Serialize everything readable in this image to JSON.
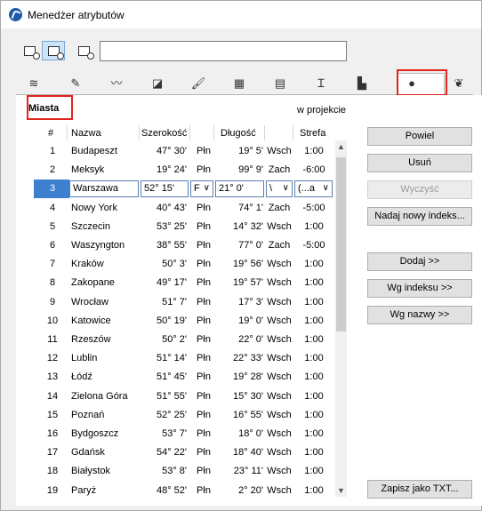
{
  "window": {
    "title": "Menedżer atrybutów"
  },
  "search": {
    "value": ""
  },
  "panel": {
    "title": "Miasta",
    "projection_label": "w projekcie"
  },
  "columns": [
    "#",
    "Nazwa",
    "Szerokość",
    "Długość",
    "Strefa"
  ],
  "rows": [
    {
      "num": "1",
      "name": "Budapeszt",
      "lat": "47° 30'",
      "latdir": "Płn",
      "lon": "19° 5'",
      "londir": "Wsch",
      "zone": "1:00"
    },
    {
      "num": "2",
      "name": "Meksyk",
      "lat": "19° 24'",
      "latdir": "Płn",
      "lon": "99° 9'",
      "londir": "Zach",
      "zone": "-6:00"
    },
    {
      "num": "3",
      "name": "Warszawa",
      "lat": "52° 15'",
      "latdir": "F",
      "lon": "21° 0'",
      "londir": "\\",
      "zone": "(...a",
      "selected": true
    },
    {
      "num": "4",
      "name": "Nowy York",
      "lat": "40° 43'",
      "latdir": "Płn",
      "lon": "74° 1'",
      "londir": "Zach",
      "zone": "-5:00"
    },
    {
      "num": "5",
      "name": "Szczecin",
      "lat": "53° 25'",
      "latdir": "Płn",
      "lon": "14° 32'",
      "londir": "Wsch",
      "zone": "1:00"
    },
    {
      "num": "6",
      "name": "Waszyngton",
      "lat": "38° 55'",
      "latdir": "Płn",
      "lon": "77° 0'",
      "londir": "Zach",
      "zone": "-5:00"
    },
    {
      "num": "7",
      "name": "Kraków",
      "lat": "50° 3'",
      "latdir": "Płn",
      "lon": "19° 56'",
      "londir": "Wsch",
      "zone": "1:00"
    },
    {
      "num": "8",
      "name": "Zakopane",
      "lat": "49° 17'",
      "latdir": "Płn",
      "lon": "19° 57'",
      "londir": "Wsch",
      "zone": "1:00"
    },
    {
      "num": "9",
      "name": "Wrocław",
      "lat": "51° 7'",
      "latdir": "Płn",
      "lon": "17° 3'",
      "londir": "Wsch",
      "zone": "1:00"
    },
    {
      "num": "10",
      "name": "Katowice",
      "lat": "50° 19'",
      "latdir": "Płn",
      "lon": "19° 0'",
      "londir": "Wsch",
      "zone": "1:00"
    },
    {
      "num": "11",
      "name": "Rzeszów",
      "lat": "50° 2'",
      "latdir": "Płn",
      "lon": "22° 0'",
      "londir": "Wsch",
      "zone": "1:00"
    },
    {
      "num": "12",
      "name": "Lublin",
      "lat": "51° 14'",
      "latdir": "Płn",
      "lon": "22° 33'",
      "londir": "Wsch",
      "zone": "1:00"
    },
    {
      "num": "13",
      "name": "Łódź",
      "lat": "51° 45'",
      "latdir": "Płn",
      "lon": "19° 28'",
      "londir": "Wsch",
      "zone": "1:00"
    },
    {
      "num": "14",
      "name": "Zielona Góra",
      "lat": "51° 55'",
      "latdir": "Płn",
      "lon": "15° 30'",
      "londir": "Wsch",
      "zone": "1:00"
    },
    {
      "num": "15",
      "name": "Poznań",
      "lat": "52° 25'",
      "latdir": "Płn",
      "lon": "16° 55'",
      "londir": "Wsch",
      "zone": "1:00"
    },
    {
      "num": "16",
      "name": "Bydgoszcz",
      "lat": "53° 7'",
      "latdir": "Płn",
      "lon": "18° 0'",
      "londir": "Wsch",
      "zone": "1:00"
    },
    {
      "num": "17",
      "name": "Gdańsk",
      "lat": "54° 22'",
      "latdir": "Płn",
      "lon": "18° 40'",
      "londir": "Wsch",
      "zone": "1:00"
    },
    {
      "num": "18",
      "name": "Białystok",
      "lat": "53° 8'",
      "latdir": "Płn",
      "lon": "23° 11'",
      "londir": "Wsch",
      "zone": "1:00"
    },
    {
      "num": "19",
      "name": "Paryż",
      "lat": "48° 52'",
      "latdir": "Płn",
      "lon": "2° 20'",
      "londir": "Wsch",
      "zone": "1:00"
    }
  ],
  "buttons": {
    "duplicate": "Powiel",
    "delete": "Usuń",
    "clear": "Wyczyść",
    "new_index": "Nadaj nowy indeks...",
    "add": "Dodaj >>",
    "by_index": "Wg indeksu >>",
    "by_name": "Wg nazwy >>",
    "save_txt": "Zapisz jako TXT..."
  },
  "icons": {
    "view_modes": [
      "view-list-icon",
      "view-split-icon",
      "view-detail-icon"
    ],
    "tabs": [
      "layers-icon",
      "pen-icon",
      "line-type-icon",
      "fill-icon",
      "surface-icon",
      "building-material-icon",
      "composite-icon",
      "profile-icon",
      "zone-category-icon",
      "city-globe-icon",
      "markup-icon"
    ]
  },
  "colors": {
    "selection": "#3f7fcf",
    "highlight_frame": "#e3231e"
  }
}
